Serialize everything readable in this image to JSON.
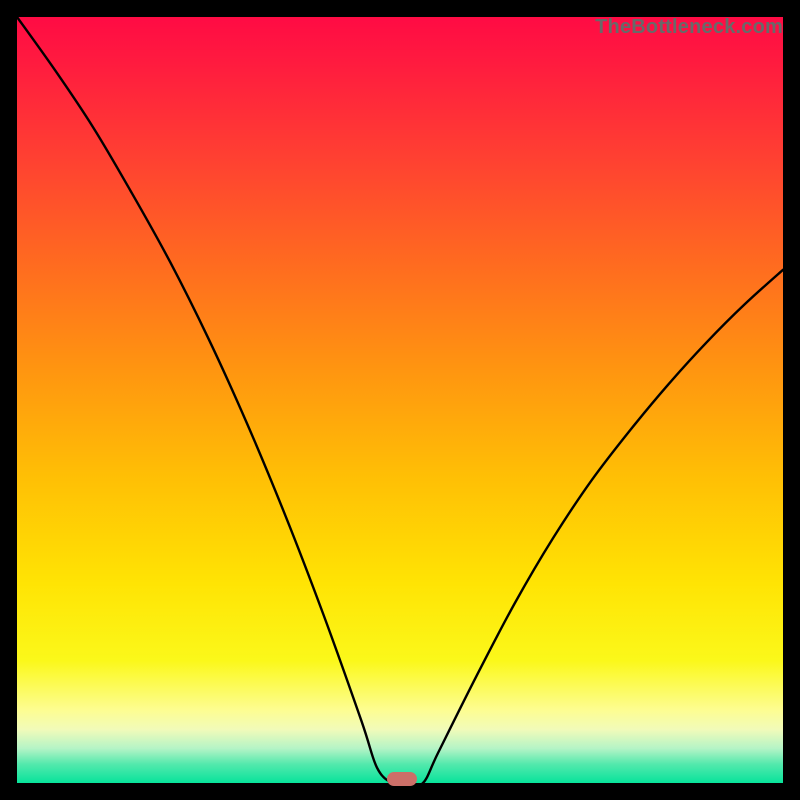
{
  "attribution": "TheBottleneck.com",
  "colors": {
    "frame": "#000000",
    "gradient_top": "#ff0b44",
    "gradient_bottom": "#08e39b",
    "curve": "#000000",
    "marker": "#cc6f68"
  },
  "chart_data": {
    "type": "line",
    "title": "",
    "xlabel": "",
    "ylabel": "",
    "xlim": [
      0,
      100
    ],
    "ylim": [
      0,
      100
    ],
    "series": [
      {
        "name": "bottleneck-curve",
        "x": [
          0,
          5,
          10,
          15,
          20,
          25,
          30,
          35,
          40,
          45,
          47,
          49,
          51,
          53,
          55,
          60,
          65,
          70,
          75,
          80,
          85,
          90,
          95,
          100
        ],
        "values": [
          100,
          93,
          85.5,
          77,
          68,
          58,
          47,
          35,
          22,
          8,
          2,
          0,
          0,
          0,
          4,
          14,
          23.5,
          32,
          39.5,
          46,
          52,
          57.5,
          62.5,
          67
        ]
      }
    ],
    "marker": {
      "x": 50.3,
      "y": 0.5
    },
    "grid": false,
    "legend": false
  }
}
